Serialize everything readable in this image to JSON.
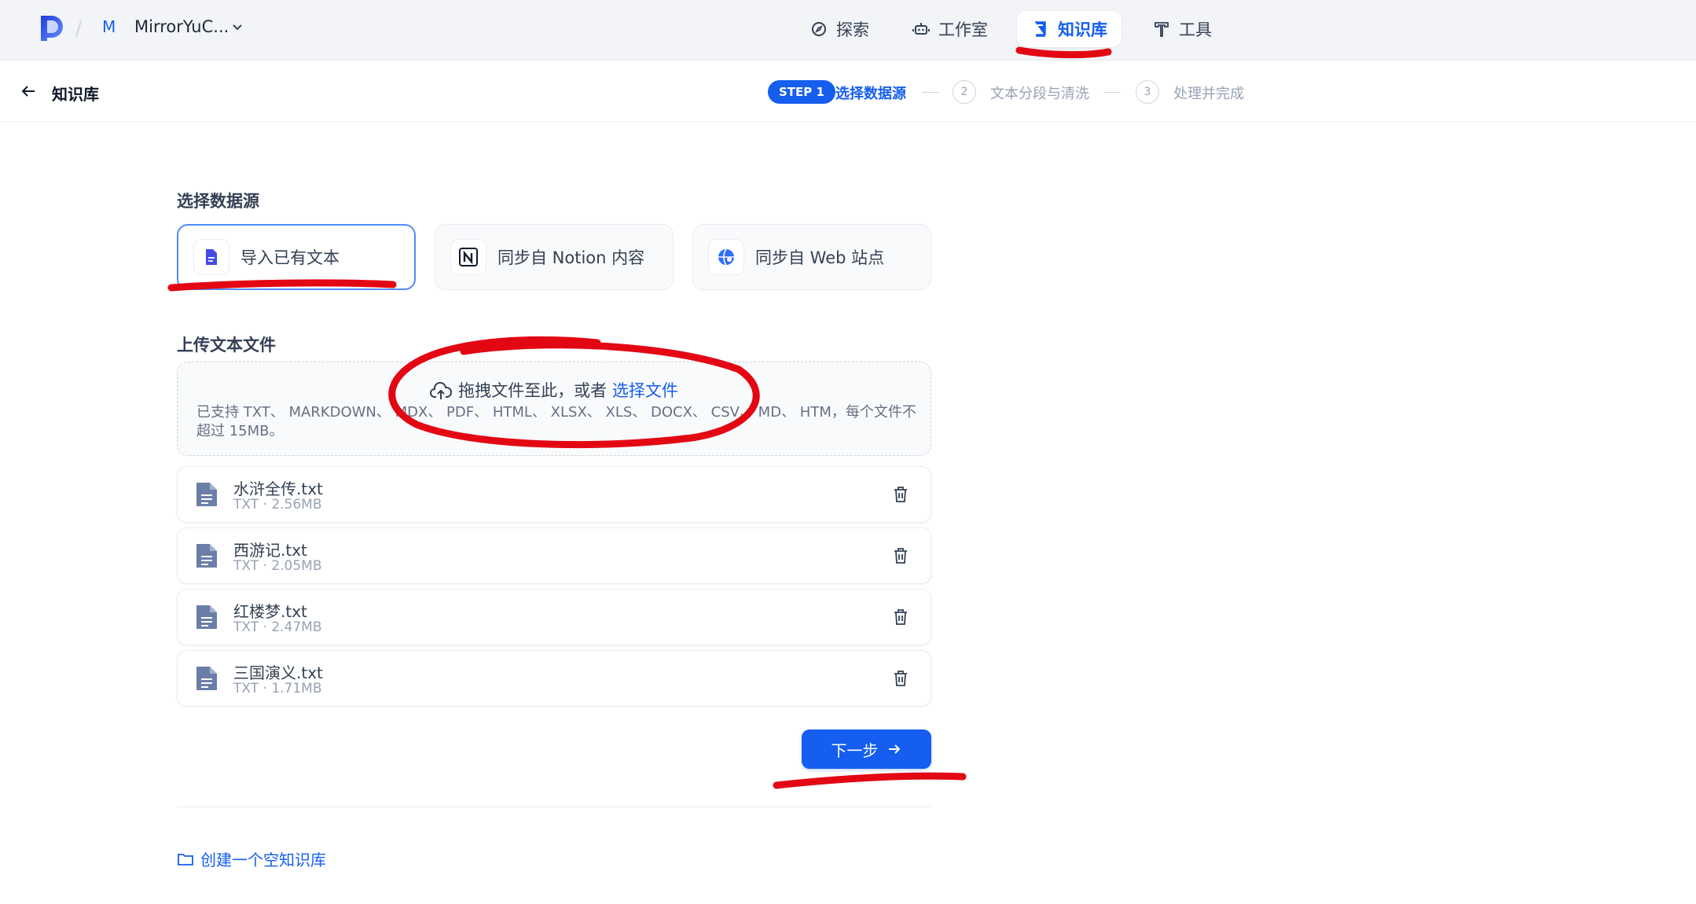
{
  "topbar": {
    "workspace_badge": "M",
    "workspace_name": "MirrorYuC...",
    "nav": [
      {
        "label": "探索",
        "icon": "compass-icon"
      },
      {
        "label": "工作室",
        "icon": "robot-icon"
      },
      {
        "label": "知识库",
        "icon": "book-icon",
        "active": true
      },
      {
        "label": "工具",
        "icon": "hammer-icon"
      }
    ]
  },
  "subheader": {
    "title": "知识库",
    "steps": [
      {
        "badge": "STEP 1",
        "label": "选择数据源",
        "active": true
      },
      {
        "number": "2",
        "label": "文本分段与清洗",
        "active": false
      },
      {
        "number": "3",
        "label": "处理并完成",
        "active": false
      }
    ]
  },
  "datasource": {
    "title": "选择数据源",
    "options": [
      {
        "label": "导入已有文本",
        "icon": "file-text-icon",
        "selected": true
      },
      {
        "label": "同步自 Notion 内容",
        "icon": "notion-icon",
        "selected": false
      },
      {
        "label": "同步自 Web 站点",
        "icon": "web-icon",
        "selected": false
      }
    ]
  },
  "upload": {
    "title": "上传文本文件",
    "drop_text": "拖拽文件至此，或者",
    "drop_link": "选择文件",
    "hint": "已支持 TXT、 MARKDOWN、 MDX、 PDF、 HTML、 XLSX、 XLS、 DOCX、 CSV、 MD、 HTM，每个文件不超过 15MB。"
  },
  "files": [
    {
      "name": "水浒全传.txt",
      "meta": "TXT · 2.56MB"
    },
    {
      "name": "西游记.txt",
      "meta": "TXT · 2.05MB"
    },
    {
      "name": "红楼梦.txt",
      "meta": "TXT · 2.47MB"
    },
    {
      "name": "三国演义.txt",
      "meta": "TXT · 1.71MB"
    }
  ],
  "actions": {
    "next_label": "下一步",
    "create_empty": "创建一个空知识库"
  },
  "colors": {
    "accent": "#155eef",
    "annotation": "#e30613"
  }
}
